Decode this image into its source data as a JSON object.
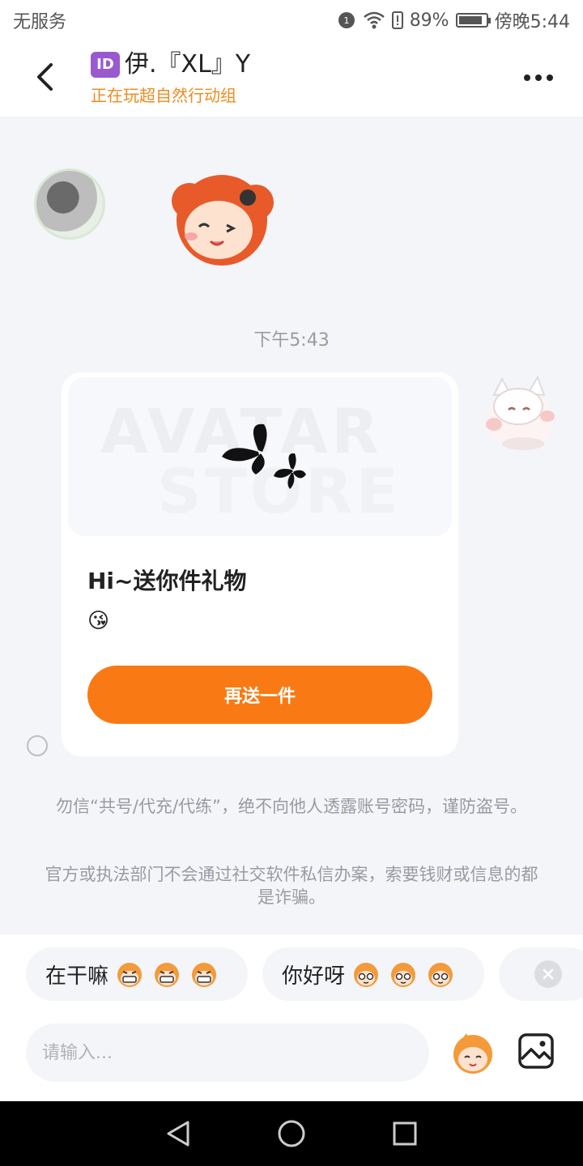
{
  "status_bar": {
    "carrier": "无服务",
    "battery": "89%",
    "battery_level": 0.89,
    "time": "傍晚5:44"
  },
  "header": {
    "id_badge": "ID",
    "contact_name": "伊.『XL』Y",
    "activity": "正在玩超自然行动组"
  },
  "chat": {
    "timestamp": "下午5:43",
    "gift_card": {
      "watermark_line1": "AVATAR",
      "watermark_line2": "STORE",
      "title": "Hi~送你件礼物",
      "emoji": "😘",
      "button_label": "再送一件"
    },
    "notice_1": "勿信“共号/代充/代练”，绝不向他人透露账号密码，谨防盗号。",
    "notice_2": "官方或执法部门不会通过社交软件私信办案，索要钱财或信息的都是诈骗。"
  },
  "quick_replies": [
    {
      "text": "在干嘛"
    },
    {
      "text": "你好呀"
    }
  ],
  "input": {
    "placeholder": "请输入..."
  },
  "colors": {
    "accent": "#f97a14",
    "subtitle": "#f08a1f",
    "background": "#f4f5f9",
    "id_badge": "#9b59d0"
  },
  "icons": [
    "back-arrow-icon",
    "more-dots-icon",
    "emoji-icon",
    "image-icon",
    "close-icon",
    "nav-back-icon",
    "nav-home-icon",
    "nav-recents-icon"
  ]
}
